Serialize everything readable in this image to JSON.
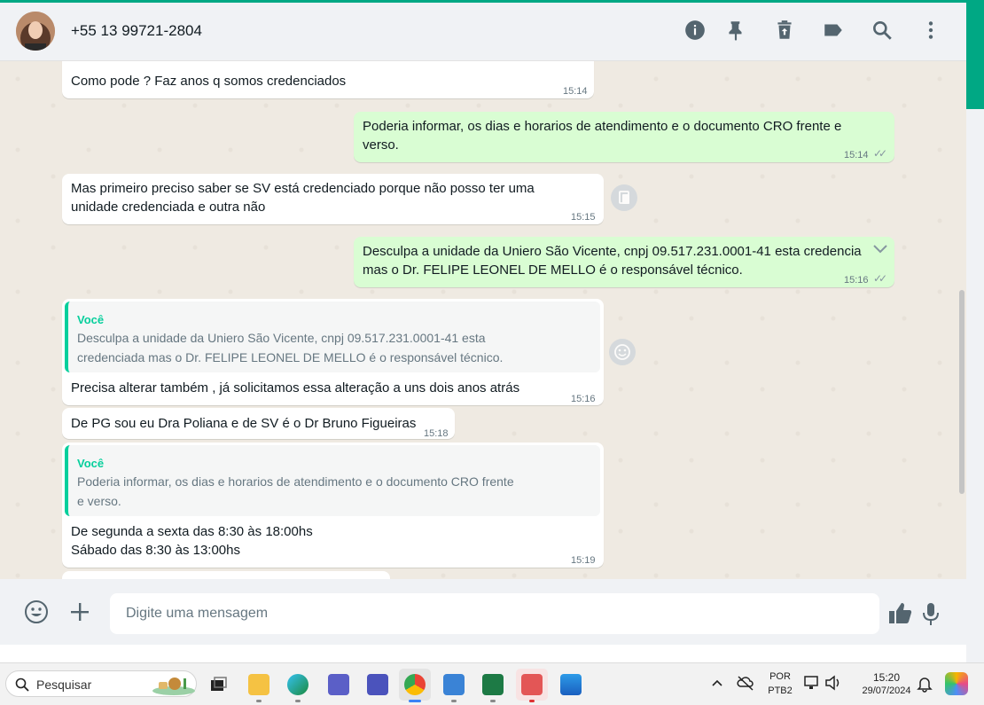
{
  "header": {
    "contact_name": "+55 13 99721-2804",
    "icons": [
      "info-icon",
      "pin-icon",
      "delete-icon",
      "label-icon",
      "search-icon",
      "more-icon"
    ]
  },
  "messages": [
    {
      "kind": "in",
      "text": "Como pode ? Faz anos q somos credenciados",
      "time": "15:14"
    },
    {
      "kind": "out",
      "line1": "Poderia informar, os dias e horarios de atendimento e o documento CRO frente e",
      "line2": "verso.",
      "time": "15:14"
    },
    {
      "kind": "in",
      "line1": "Mas primeiro preciso saber se SV está credenciado porque não posso ter uma",
      "line2": "unidade credenciada e outra não",
      "time": "15:15"
    },
    {
      "kind": "out",
      "line1": "Desculpa a unidade da Uniero São Vicente, cnpj 09.517.231.0001-41 esta credencia",
      "line2": "mas o Dr. FELIPE LEONEL DE MELLO é o responsável técnico.",
      "time": "15:16"
    },
    {
      "kind": "in",
      "quote_author": "Você",
      "quote_line1": "Desculpa a unidade da Uniero São Vicente, cnpj 09.517.231.0001-41 esta",
      "quote_line2": "credenciada mas o Dr. FELIPE LEONEL DE MELLO é o responsável técnico.",
      "text": "Precisa alterar também , já solicitamos essa alteração a uns dois anos atrás",
      "time": "15:16"
    },
    {
      "kind": "in",
      "text": "De PG sou eu Dra Poliana e de SV é o Dr Bruno Figueiras",
      "time": "15:18"
    },
    {
      "kind": "in",
      "quote_author": "Você",
      "quote_line1": "Poderia informar, os dias e horarios de atendimento e o documento CRO frente",
      "quote_line2": "e verso.",
      "line1": "De segunda a sexta das 8:30 às 18:00hs",
      "line2": "Sábado das 8:30 às 13:00hs",
      "time": "15:19"
    }
  ],
  "composer": {
    "placeholder": "Digite uma mensagem"
  },
  "taskbar": {
    "search_label": "Pesquisar",
    "lang_top": "POR",
    "lang_bottom": "PTB2",
    "time": "15:20",
    "date": "29/07/2024"
  },
  "colors": {
    "accent": "#00a884",
    "bubble_out": "#d9fdd3",
    "bubble_in": "#ffffff",
    "chat_bg": "#efeae2"
  }
}
